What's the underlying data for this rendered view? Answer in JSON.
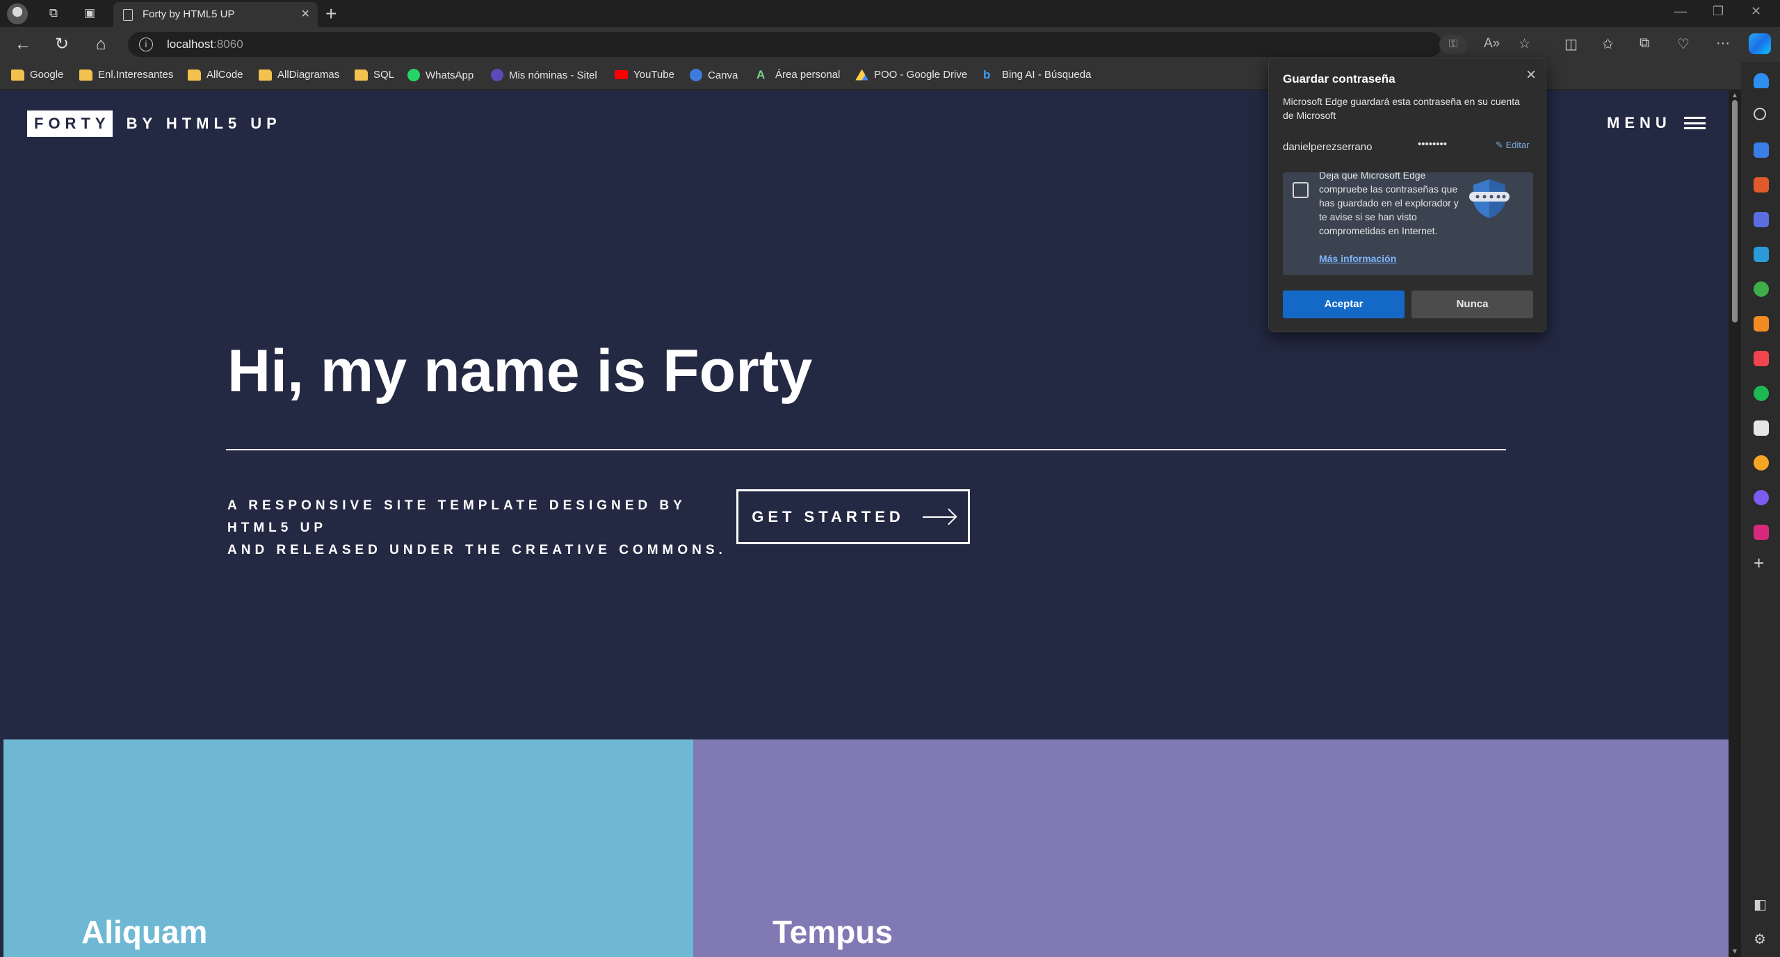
{
  "browser": {
    "tab_title": "Forty by HTML5 UP",
    "url_host": "localhost",
    "url_port": ":8060"
  },
  "bookmarks": [
    {
      "label": "Google",
      "icon": "folder-icon"
    },
    {
      "label": "Enl.Interesantes",
      "icon": "folder-icon"
    },
    {
      "label": "AllCode",
      "icon": "folder-icon"
    },
    {
      "label": "AllDiagramas",
      "icon": "folder-icon"
    },
    {
      "label": "SQL",
      "icon": "folder-icon"
    },
    {
      "label": "WhatsApp",
      "icon": "whatsapp-icon"
    },
    {
      "label": "Mis nóminas - Sitel",
      "icon": "sitel-icon"
    },
    {
      "label": "YouTube",
      "icon": "youtube-icon"
    },
    {
      "label": "Canva",
      "icon": "canva-icon"
    },
    {
      "label": "Área personal",
      "icon": "area-personal-icon"
    },
    {
      "label": "POO - Google Drive",
      "icon": "google-drive-icon"
    },
    {
      "label": "Bing AI - Búsqueda",
      "icon": "bing-icon"
    }
  ],
  "page": {
    "logo_box": "FORTY",
    "logo_tail": "BY HTML5 UP",
    "menu_label": "MENU",
    "hero_title": "Hi, my name is Forty",
    "hero_subtitle_line1": "A RESPONSIVE SITE TEMPLATE DESIGNED BY HTML5 UP",
    "hero_subtitle_line2": "AND RELEASED UNDER THE CREATIVE COMMONS.",
    "cta_label": "GET STARTED",
    "tiles": [
      {
        "label": "Aliquam",
        "color": "#6fb8d4"
      },
      {
        "label": "Tempus",
        "color": "#8179b4"
      }
    ],
    "background_color": "#242943"
  },
  "password_popup": {
    "title": "Guardar contraseña",
    "description": "Microsoft Edge guardará esta contraseña en su cuenta de Microsoft",
    "username": "danielperezserrano",
    "password_mask": "••••••••",
    "edit_label": "Editar",
    "promo_text": "Deja que Microsoft Edge compruebe las contraseñas que has guardado en el explorador y te avise si se han visto comprometidas en Internet.",
    "more_info": "Más información",
    "accept_label": "Aceptar",
    "never_label": "Nunca",
    "accent_color": "#1469c7"
  }
}
